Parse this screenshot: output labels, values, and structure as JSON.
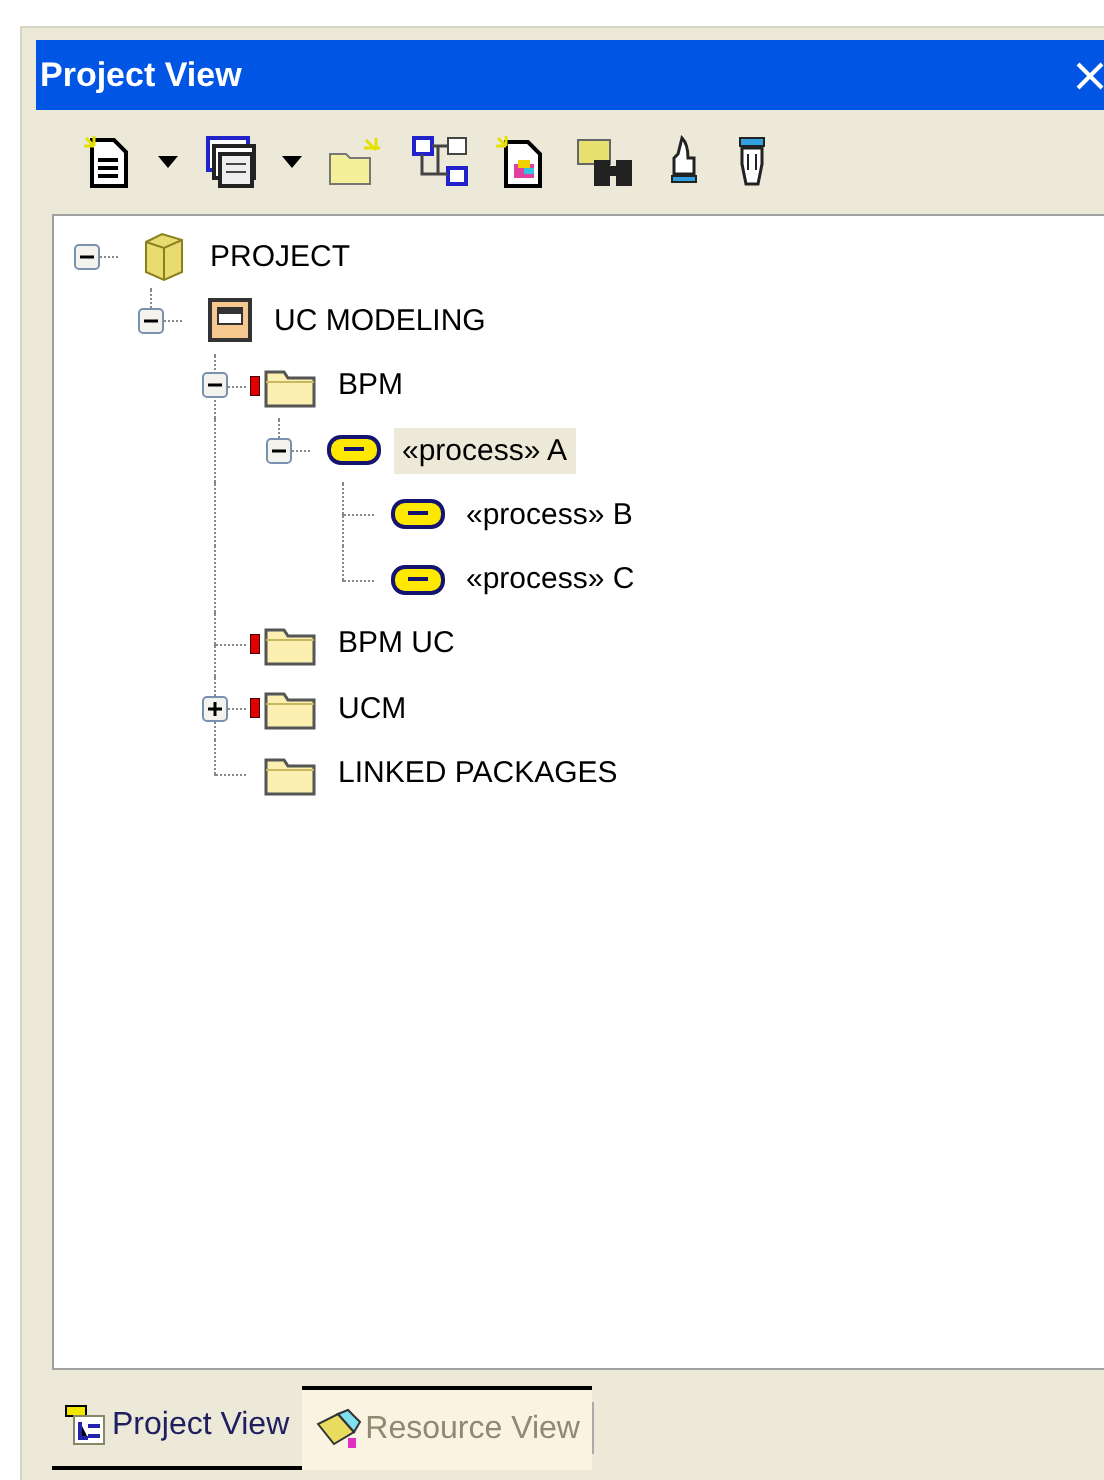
{
  "window": {
    "title": "Project View"
  },
  "tree": [
    {
      "label": "PROJECT",
      "kind": "project",
      "expanded": true,
      "selected": false,
      "children": [
        {
          "label": "UC MODELING",
          "kind": "model",
          "expanded": true,
          "selected": false,
          "children": [
            {
              "label": "BPM",
              "kind": "package",
              "marked": true,
              "expanded": true,
              "selected": false,
              "children": [
                {
                  "label": "«process» A",
                  "kind": "process",
                  "expanded": true,
                  "selected": true,
                  "children": [
                    {
                      "label": "«process» B",
                      "kind": "process",
                      "selected": false
                    },
                    {
                      "label": "«process» C",
                      "kind": "process",
                      "selected": false
                    }
                  ]
                }
              ]
            },
            {
              "label": "BPM UC",
              "kind": "package",
              "marked": true,
              "selected": false
            },
            {
              "label": "UCM",
              "kind": "package",
              "marked": true,
              "expanded": false,
              "selected": false
            },
            {
              "label": "LINKED PACKAGES",
              "kind": "package",
              "marked": false,
              "selected": false
            }
          ]
        }
      ]
    }
  ],
  "tabs": [
    {
      "label": "Project View",
      "selected": true
    },
    {
      "label": "Resource View",
      "selected": false
    }
  ]
}
